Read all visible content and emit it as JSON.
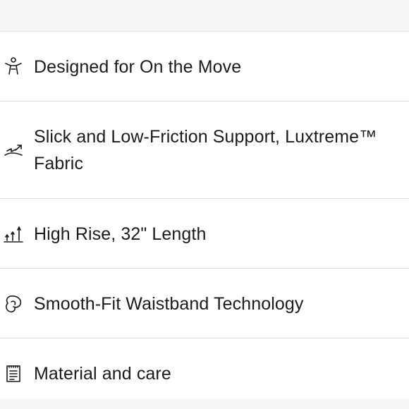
{
  "features": {
    "items": [
      {
        "icon": "person-movement-icon",
        "label": "Designed for On the Move"
      },
      {
        "icon": "low-friction-fabric-icon",
        "label": "Slick and Low-Friction Support, Luxtreme™ Fabric"
      },
      {
        "icon": "high-rise-length-icon",
        "label": "High Rise, 32\" Length"
      },
      {
        "icon": "waistband-icon",
        "label": "Smooth-Fit Waistband Technology"
      },
      {
        "icon": "material-care-icon",
        "label": "Material and care"
      }
    ]
  }
}
